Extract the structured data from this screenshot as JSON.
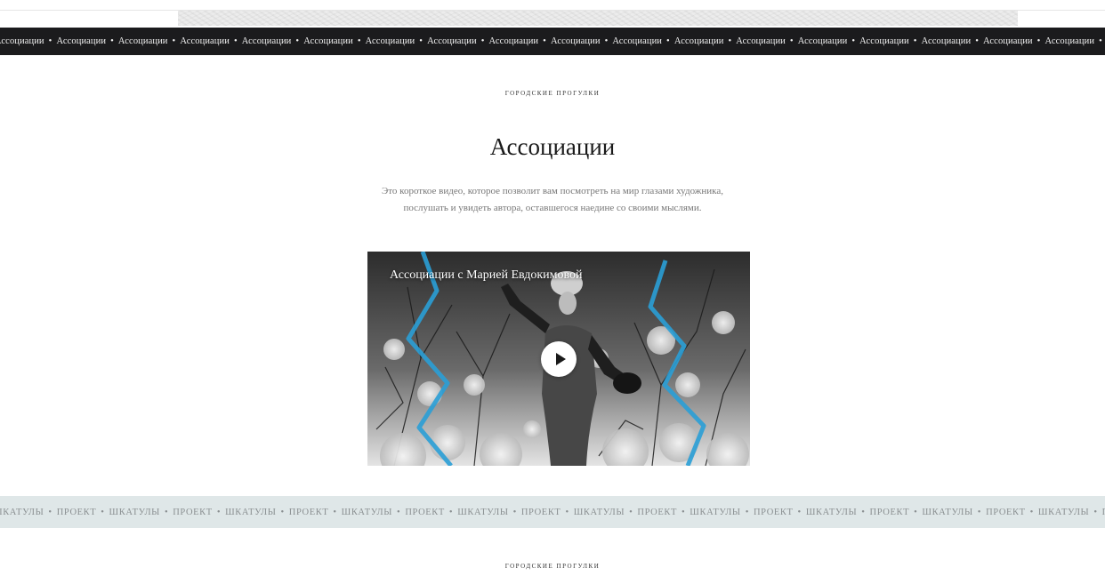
{
  "top_marquee": {
    "text": "Ассоциации",
    "separator": "•",
    "repeat": 24
  },
  "section": {
    "kicker": "городские прогулки",
    "title": "Ассоциации",
    "description": "Это короткое видео, которое позволит вам посмотреть на мир глазами художника, послушать и увидеть автора, оставшегося наедине со своими мыслями."
  },
  "video": {
    "title": "Ассоциации с Марией Евдокимовой",
    "play_icon": "play-icon"
  },
  "bottom_marquee": {
    "items": [
      "ШКАТУЛЫ",
      "ПРОЕКТ"
    ],
    "separator": "•",
    "repeat": 20
  },
  "next_section": {
    "kicker": "городские прогулки"
  },
  "colors": {
    "dark_strip": "#1b1b1d",
    "light_strip": "#dfe7e8",
    "accent_blue": "#2a9fd6"
  }
}
